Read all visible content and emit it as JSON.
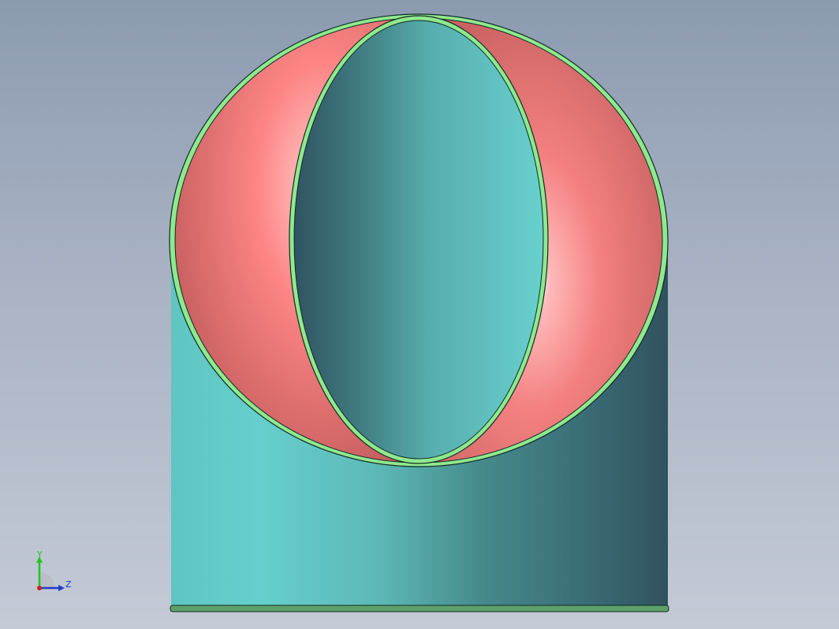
{
  "viewport": {
    "model_colors": {
      "cylinder_light": "#66cfcc",
      "cylinder_dark": "#30525e",
      "cut_face_light": "#ff8e8e",
      "cut_face_dark": "#c96060",
      "rim": "#90e88e",
      "edge": "#0d2b23"
    }
  },
  "triad": {
    "y_label": "Y",
    "z_label": "Z",
    "y_color": "#1ec81e",
    "z_color": "#1e3cc8"
  }
}
